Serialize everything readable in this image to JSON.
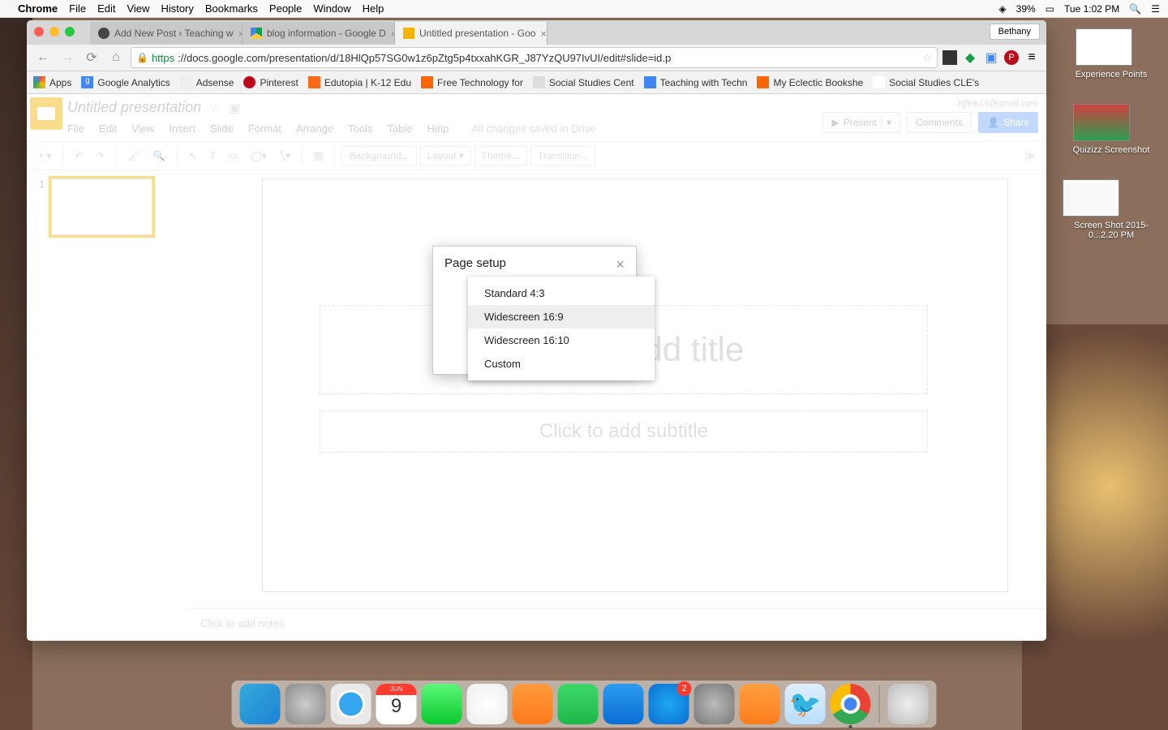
{
  "menubar": {
    "app": "Chrome",
    "items": [
      "File",
      "Edit",
      "View",
      "History",
      "Bookmarks",
      "People",
      "Window",
      "Help"
    ],
    "battery": "39%",
    "clock": "Tue 1:02 PM"
  },
  "browser": {
    "profile": "Bethany",
    "tabs": [
      {
        "title": "Add New Post ‹ Teaching w",
        "active": false,
        "icon": "wp"
      },
      {
        "title": "blog information - Google D",
        "active": false,
        "icon": "drive"
      },
      {
        "title": "Untitled presentation - Goo",
        "active": true,
        "icon": "slides"
      }
    ],
    "url_prefix": "https",
    "url": "://docs.google.com/presentation/d/18HlQp57SG0w1z6pZtg5p4txxahKGR_J87YzQU97IvUI/edit#slide=id.p",
    "bookmarks": [
      {
        "label": "Apps",
        "icon": "apps"
      },
      {
        "label": "Google Analytics",
        "icon": "g"
      },
      {
        "label": "Adsense",
        "icon": "ad"
      },
      {
        "label": "Pinterest",
        "icon": "pin"
      },
      {
        "label": "Edutopia | K-12 Edu",
        "icon": "edu"
      },
      {
        "label": "Free Technology for",
        "icon": "b"
      },
      {
        "label": "Social Studies Cent",
        "icon": "ss"
      },
      {
        "label": "Teaching with Techn",
        "icon": "g"
      },
      {
        "label": "My Eclectic Bookshe",
        "icon": "b"
      },
      {
        "label": "Social Studies CLE's",
        "icon": "ss2"
      }
    ]
  },
  "slides": {
    "doc_title": "Untitled presentation",
    "email": "bjfink1s@gmail.com",
    "menus": [
      "File",
      "Edit",
      "View",
      "Insert",
      "Slide",
      "Format",
      "Arrange",
      "Tools",
      "Table",
      "Help"
    ],
    "saved": "All changes saved in Drive",
    "present": "Present",
    "comments": "Comments",
    "share": "Share",
    "toolbar_texts": {
      "bg": "Background...",
      "layout": "Layout",
      "theme": "Theme...",
      "transition": "Transition..."
    },
    "thumb_num": "1",
    "title_placeholder": "Click to add title",
    "subtitle_placeholder": "Click to add subtitle",
    "notes_placeholder": "Click to add notes"
  },
  "modal": {
    "title": "Page setup",
    "options": [
      "Standard 4:3",
      "Widescreen 16:9",
      "Widescreen 16:10",
      "Custom"
    ],
    "highlighted": 1
  },
  "desktop": {
    "items": [
      {
        "label": "Experience Points"
      },
      {
        "label": "Quizizz Screenshot"
      },
      {
        "label": "Screen Shot 2015-0...2.20 PM"
      }
    ]
  },
  "dock": {
    "items": [
      {
        "name": "finder",
        "bg": "linear-gradient(135deg,#34aadc,#1e82d4)"
      },
      {
        "name": "launchpad",
        "bg": "radial-gradient(circle,#ccc,#888)"
      },
      {
        "name": "safari",
        "bg": "radial-gradient(circle,#35a6f0 40%,#fff 42%,#fff 48%,#e9e9e9 50%)"
      },
      {
        "name": "calendar",
        "bg": "linear-gradient(#fff 30%,#fff 30%)",
        "text": "9",
        "top": "JUN"
      },
      {
        "name": "messages",
        "bg": "linear-gradient(#5cf777,#0ac92e)"
      },
      {
        "name": "photos",
        "bg": "radial-gradient(circle,#fff,#eee)"
      },
      {
        "name": "pages",
        "bg": "linear-gradient(#ff9a3c,#ff7a1c)"
      },
      {
        "name": "numbers",
        "bg": "linear-gradient(#3cd968,#1eb74a)"
      },
      {
        "name": "keynote",
        "bg": "linear-gradient(#2d9cf0,#0a6ed4)"
      },
      {
        "name": "appstore",
        "bg": "radial-gradient(circle,#1fa8f0,#0a6ed4)",
        "badge": "2"
      },
      {
        "name": "settings",
        "bg": "radial-gradient(circle,#bbb,#777)"
      },
      {
        "name": "calculator",
        "bg": "linear-gradient(#ff9f40,#ff7d1c)"
      },
      {
        "name": "twitter",
        "bg": "linear-gradient(#dfefff,#b8deff)"
      },
      {
        "name": "chrome",
        "bg": "conic-gradient(#ea4335 0 120deg,#34a853 120deg 240deg,#fbbc05 240deg 360deg)",
        "dot": true
      }
    ],
    "trash": {
      "name": "trash",
      "bg": "radial-gradient(circle,#eee,#bbb)"
    }
  }
}
